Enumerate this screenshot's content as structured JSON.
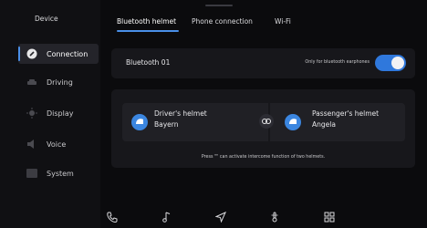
{
  "sidebar": {
    "title": "Device",
    "items": [
      {
        "label": "Connection",
        "icon": "link-icon",
        "active": true
      },
      {
        "label": "Driving",
        "icon": "car-icon",
        "active": false
      },
      {
        "label": "Display",
        "icon": "brightness-icon",
        "active": false
      },
      {
        "label": "Voice",
        "icon": "speaker-icon",
        "active": false
      },
      {
        "label": "System",
        "icon": "system-icon",
        "active": false
      }
    ]
  },
  "tabs": [
    {
      "label": "Bluetooth helmet",
      "active": true
    },
    {
      "label": "Phone connection",
      "active": false
    },
    {
      "label": "Wi-Fi",
      "active": false
    }
  ],
  "bluetooth": {
    "device_name": "Bluetooth 01",
    "switch_hint": "Only for bluetooth earphones",
    "enabled": true
  },
  "helmets": {
    "driver": {
      "title": "Driver's helmet",
      "name": "Bayern"
    },
    "passenger": {
      "title": "Passenger's helmet",
      "name": "Angela"
    },
    "hint": "Press  \"\"  can activate intercome function of two helmets."
  },
  "dock": {
    "icons": [
      "phone-icon",
      "music-icon",
      "navigation-icon",
      "temperature-icon",
      "apps-icon"
    ]
  },
  "colors": {
    "accent": "#2f78dc",
    "background": "#0b0b0d",
    "card": "#17171b"
  }
}
